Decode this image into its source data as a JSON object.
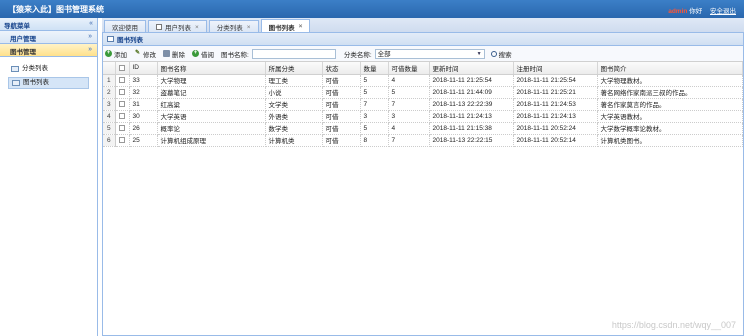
{
  "app": {
    "title": "【猿来入此】图书管理系统",
    "user": "admin",
    "greeting": "你好",
    "logout": "安全退出"
  },
  "sidebar": {
    "title": "导航菜单",
    "groups": [
      {
        "label": "用户管理"
      },
      {
        "label": "图书管理"
      }
    ],
    "items": [
      {
        "label": "分类列表"
      },
      {
        "label": "图书列表"
      }
    ]
  },
  "tabs": [
    {
      "label": "欢迎使用"
    },
    {
      "label": "用户列表"
    },
    {
      "label": "分类列表"
    },
    {
      "label": "图书列表"
    }
  ],
  "grid": {
    "title": "图书列表",
    "toolbar": {
      "add": "添加",
      "edit": "修改",
      "delete": "删除",
      "borrow": "借阅",
      "name_label": "图书名称:",
      "name_value": "",
      "category_label": "分类名称:",
      "category_value": "全部",
      "search": "搜索"
    },
    "columns": [
      "ID",
      "图书名称",
      "所属分类",
      "状态",
      "数量",
      "可借数量",
      "更新时间",
      "注册时间",
      "图书简介"
    ],
    "rows": [
      [
        "1",
        "33",
        "大学物理",
        "理工类",
        "可借",
        "5",
        "4",
        "2018-11-11 21:25:54",
        "2018-11-11 21:25:54",
        "大学物理教材。"
      ],
      [
        "2",
        "32",
        "盗墓笔记",
        "小说",
        "可借",
        "5",
        "5",
        "2018-11-11 21:44:09",
        "2018-11-11 21:25:21",
        "著名网络作家南派三叔的作品。"
      ],
      [
        "3",
        "31",
        "红高粱",
        "文学类",
        "可借",
        "7",
        "7",
        "2018-11-13 22:22:39",
        "2018-11-11 21:24:53",
        "著名作家莫言的作品。"
      ],
      [
        "4",
        "30",
        "大学英语",
        "外语类",
        "可借",
        "3",
        "3",
        "2018-11-11 21:24:13",
        "2018-11-11 21:24:13",
        "大学英语教材。"
      ],
      [
        "5",
        "26",
        "概率论",
        "数学类",
        "可借",
        "5",
        "4",
        "2018-11-11 21:15:38",
        "2018-11-11 20:52:24",
        "大学数学概率论教材。"
      ],
      [
        "6",
        "25",
        "计算机组成原理",
        "计算机类",
        "可借",
        "8",
        "7",
        "2018-11-13 22:22:15",
        "2018-11-11 20:52:14",
        "计算机类图书。"
      ]
    ]
  },
  "watermark": "https://blog.csdn.net/wqy__007",
  "colors": {
    "header": "#2a67ae",
    "accent": "#99bbe8",
    "active_group": "#ffe18c"
  }
}
